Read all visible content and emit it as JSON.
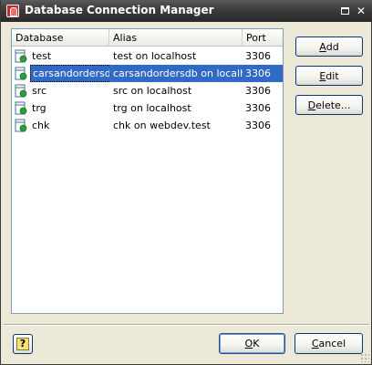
{
  "window": {
    "title": "Database Connection Manager",
    "maximize_icon": "maximize-icon",
    "close_icon": "close-icon",
    "close_glyph": "✕"
  },
  "list": {
    "columns": [
      "Database",
      "Alias",
      "Port"
    ],
    "rows": [
      {
        "database": "test",
        "alias": "test on localhost",
        "port": "3306",
        "selected": false
      },
      {
        "database": "carsandordersdb",
        "alias": "carsandordersdb on localhost",
        "port": "3306",
        "selected": true
      },
      {
        "database": "src",
        "alias": "src on localhost",
        "port": "3306",
        "selected": false
      },
      {
        "database": "trg",
        "alias": "trg on localhost",
        "port": "3306",
        "selected": false
      },
      {
        "database": "chk",
        "alias": "chk on webdev.test",
        "port": "3306",
        "selected": false
      }
    ]
  },
  "buttons": {
    "add": {
      "mnemonic": "A",
      "rest": "dd"
    },
    "edit": {
      "mnemonic": "E",
      "rest": "dit"
    },
    "delete": {
      "mnemonic": "D",
      "rest": "elete..."
    },
    "ok": {
      "mnemonic": "O",
      "rest": "K"
    },
    "cancel": {
      "mnemonic": "C",
      "rest": "ancel"
    },
    "help_glyph": "?"
  },
  "colors": {
    "selection": "#316ac5",
    "title_bar": "#3b3b3b",
    "dialog_bg": "#ece9d8",
    "db_icon_green": "#2e9e3a"
  }
}
